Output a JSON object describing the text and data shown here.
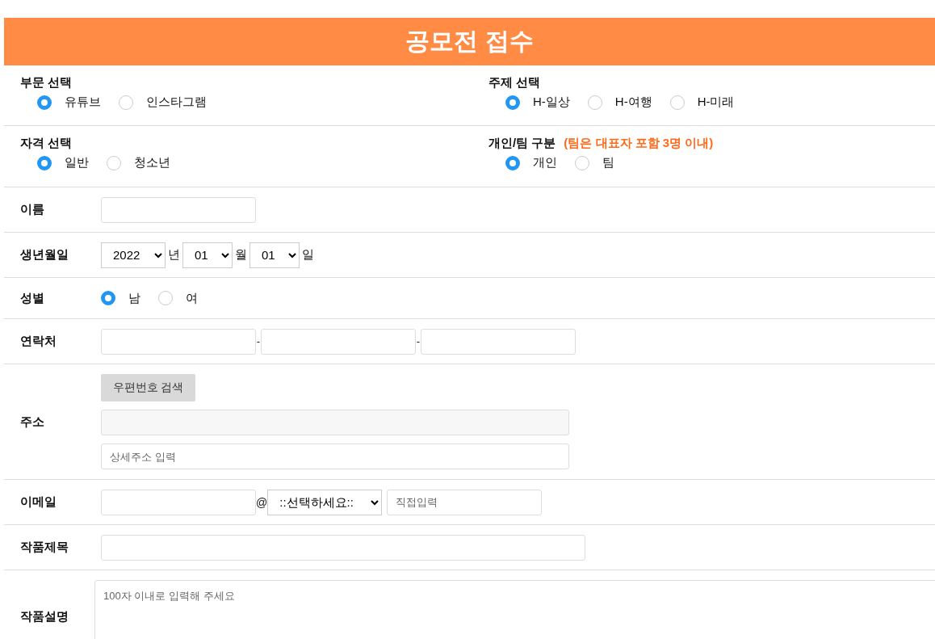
{
  "header": {
    "title": "공모전 접수"
  },
  "choice_groups": [
    {
      "label": "부문 선택",
      "options": [
        {
          "label": "유튜브",
          "selected": true
        },
        {
          "label": "인스타그램",
          "selected": false
        }
      ]
    },
    {
      "label": "주제 선택",
      "options": [
        {
          "label": "H-일상",
          "selected": true
        },
        {
          "label": "H-여행",
          "selected": false
        },
        {
          "label": "H-미래",
          "selected": false
        }
      ]
    },
    {
      "label": "자격 선택",
      "options": [
        {
          "label": "일반",
          "selected": true
        },
        {
          "label": "청소년",
          "selected": false
        }
      ]
    },
    {
      "label": "개인/팀 구분",
      "note": "(팀은 대표자 포함 3명 이내)",
      "options": [
        {
          "label": "개인",
          "selected": true
        },
        {
          "label": "팀",
          "selected": false
        }
      ]
    }
  ],
  "fields": [
    {
      "kind": "text",
      "label": "이름"
    },
    {
      "kind": "date",
      "label": "생년월일",
      "selects": [
        {
          "value": "2022",
          "unit": "년"
        },
        {
          "value": "01",
          "unit": "월"
        },
        {
          "value": "01",
          "unit": "일"
        }
      ]
    },
    {
      "kind": "radio",
      "label": "성별",
      "options": [
        {
          "label": "남",
          "selected": true
        },
        {
          "label": "여",
          "selected": false
        }
      ]
    },
    {
      "kind": "phone",
      "label": "연락처",
      "separators": [
        "-",
        "-"
      ]
    },
    {
      "kind": "address",
      "label": "주소",
      "button": "우편번호 검색",
      "detail_placeholder": "상세주소 입력"
    },
    {
      "kind": "email",
      "label": "이메일",
      "at": "@",
      "domain_select": "::선택하세요::",
      "direct_placeholder": "직접입력"
    },
    {
      "kind": "wide-text",
      "label": "작품제목"
    },
    {
      "kind": "textarea",
      "label": "작품설명",
      "placeholder": "100자 이내로 입력해 주세요"
    }
  ]
}
